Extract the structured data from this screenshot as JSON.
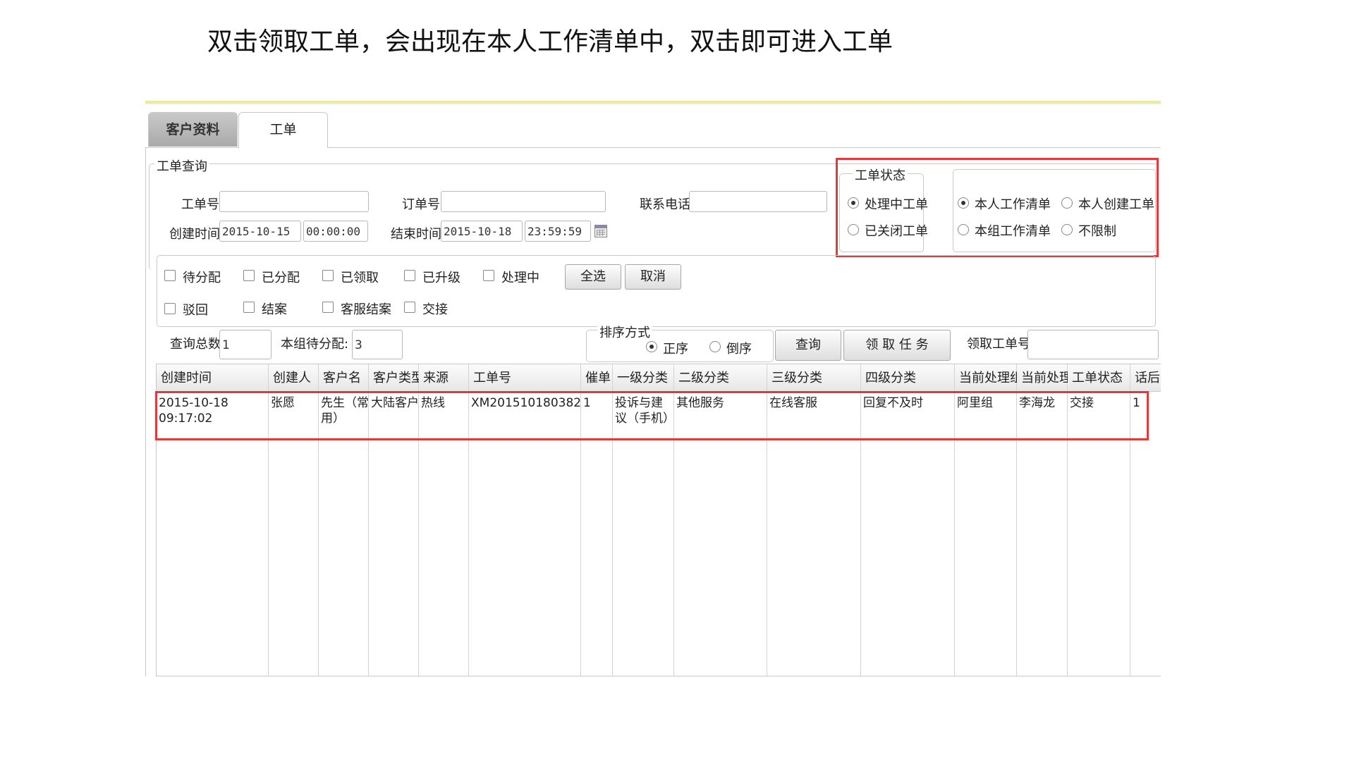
{
  "caption": "双击领取工单，会出现在本人工作清单中，双击即可进入工单",
  "tabs": {
    "customer": "客户资料",
    "ticket": "工单"
  },
  "query": {
    "legend": "工单查询",
    "ticket_no_label": "工单号",
    "order_no_label": "订单号",
    "phone_label": "联系电话",
    "create_time_label": "创建时间",
    "create_date": "2015-10-15",
    "create_clock": "00:00:00",
    "end_time_label": "结束时间",
    "end_date": "2015-10-18",
    "end_clock": "23:59:59"
  },
  "status": {
    "legend": "工单状态",
    "processing": "处理中工单",
    "closed": "已关闭工单",
    "my_list": "本人工作清单",
    "my_created": "本人创建工单",
    "group_list": "本组工作清单",
    "unlimited": "不限制"
  },
  "filters": {
    "row1": [
      "待分配",
      "已分配",
      "已领取",
      "已升级",
      "处理中"
    ],
    "row2": [
      "驳回",
      "结案",
      "客服结案",
      "交接"
    ],
    "select_all": "全选",
    "cancel": "取消"
  },
  "summary": {
    "total_label": "查询总数",
    "total_value": "1",
    "group_pending_label": "本组待分配:",
    "group_pending_value": "3",
    "sort_legend": "排序方式",
    "sort_asc": "正序",
    "sort_desc": "倒序",
    "query_btn": "查询",
    "claim_btn": "领 取 任 务",
    "claim_no_label": "领取工单号"
  },
  "table": {
    "headers": [
      "创建时间",
      "创建人",
      "客户名",
      "客户类型",
      "来源",
      "工单号",
      "催单",
      "一级分类",
      "二级分类",
      "三级分类",
      "四级分类",
      "当前处理组",
      "当前处理人",
      "工单状态",
      "话后"
    ],
    "rows": [
      [
        "2015-10-18 09:17:02",
        "张愿",
        "先生（常用）",
        "大陆客户",
        "热线",
        "XM201510180382",
        "1",
        "投诉与建议（手机）",
        "其他服务",
        "在线客服",
        "回复不及时",
        "阿里组",
        "李海龙",
        "交接",
        "1"
      ]
    ]
  }
}
